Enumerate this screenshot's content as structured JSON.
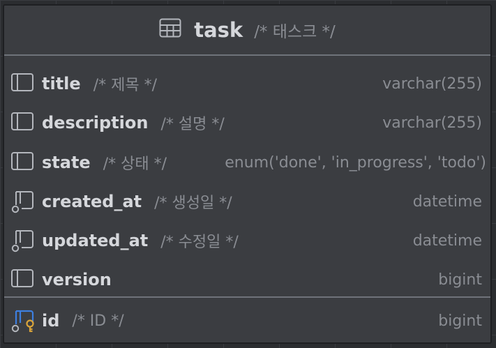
{
  "table": {
    "name": "task",
    "comment": "/* 태스크 */",
    "icon": "table-icon"
  },
  "columns": [
    {
      "name": "title",
      "comment": "/* 제목 */",
      "type": "varchar(255)",
      "icon": "column-icon"
    },
    {
      "name": "description",
      "comment": "/* 설명 */",
      "type": "varchar(255)",
      "icon": "column-icon"
    },
    {
      "name": "state",
      "comment": "/* 상태 */",
      "type": "enum('done', 'in_progress', 'todo')",
      "icon": "column-icon"
    },
    {
      "name": "created_at",
      "comment": "/* 생성일 */",
      "type": "datetime",
      "icon": "not-null-column-icon"
    },
    {
      "name": "updated_at",
      "comment": "/* 수정일 */",
      "type": "datetime",
      "icon": "not-null-column-icon"
    },
    {
      "name": "version",
      "comment": "",
      "type": "bigint",
      "icon": "column-icon"
    }
  ],
  "primary_key": {
    "name": "id",
    "comment": "/* ID */",
    "type": "bigint",
    "icon": "primary-key-column-icon"
  },
  "colors": {
    "background": "#2b2d30",
    "card": "#3b3d41",
    "name_text": "#d5d7db",
    "muted_text": "#8a8d93",
    "key_blue": "#3d7fe0",
    "key_gold": "#d9a43a"
  }
}
